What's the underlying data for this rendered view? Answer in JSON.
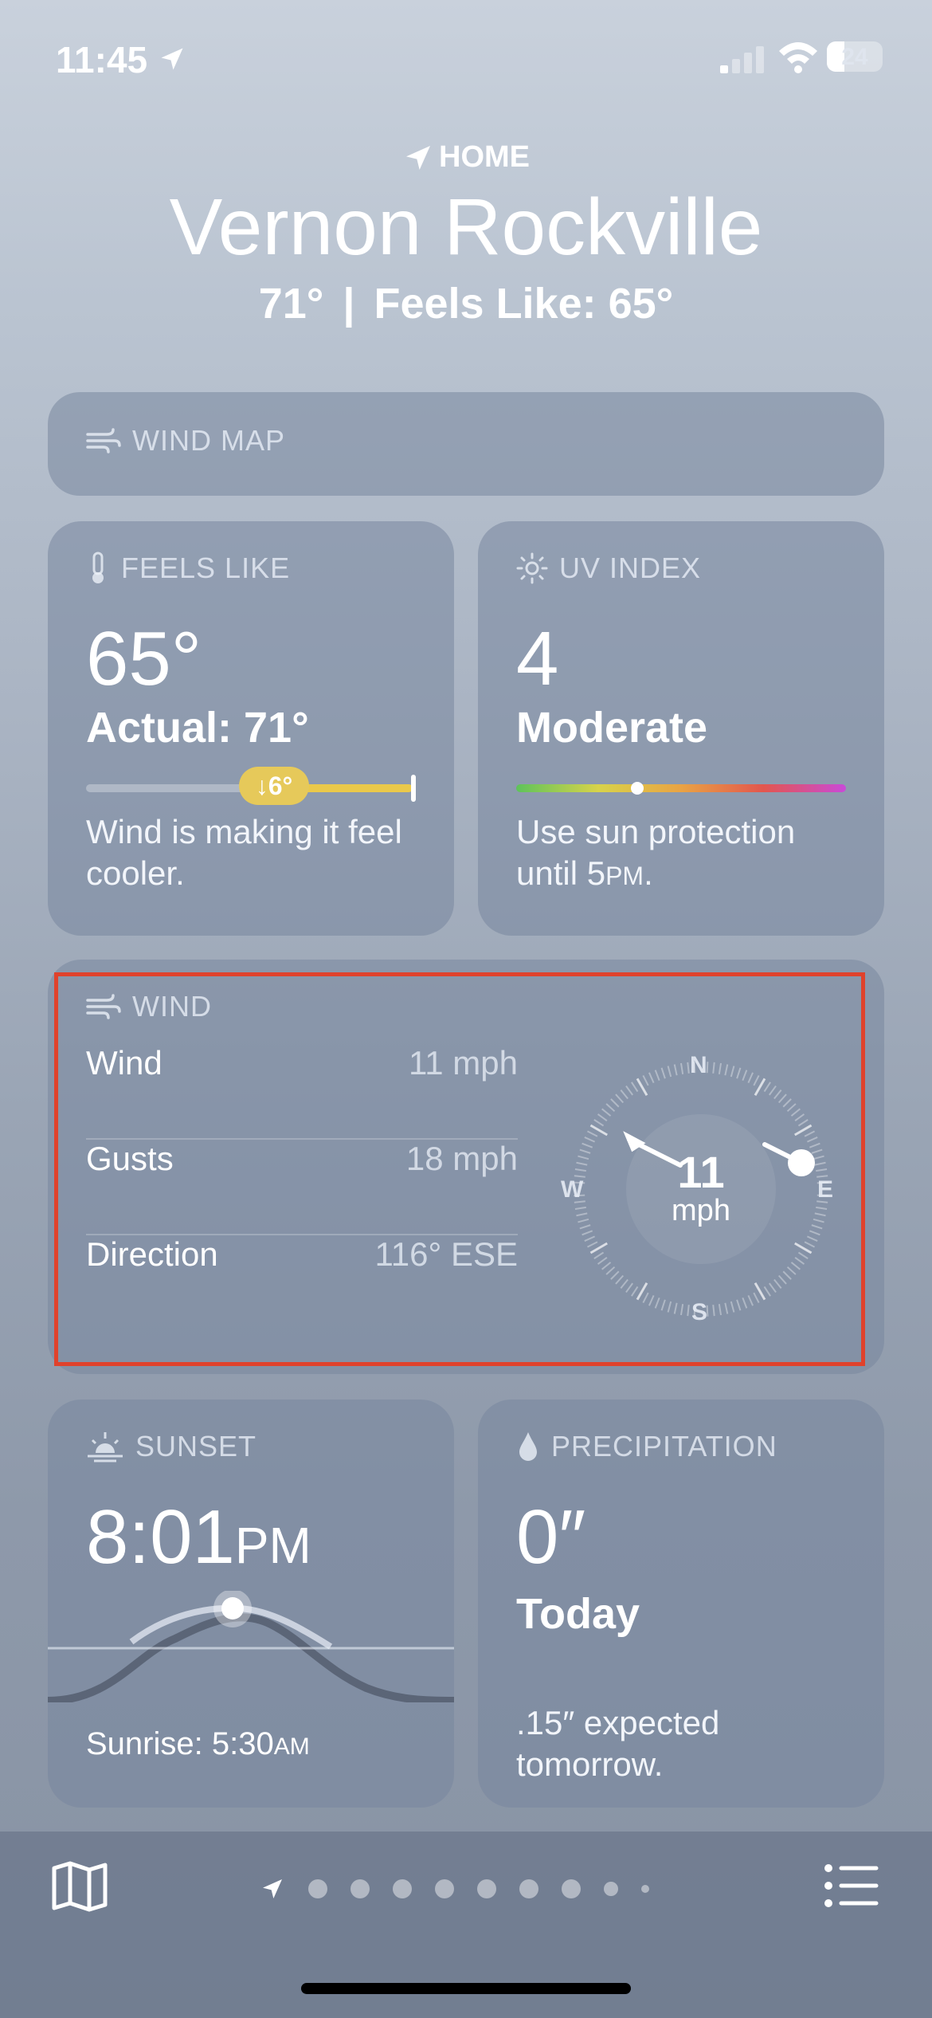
{
  "status": {
    "time": "11:45",
    "battery": "24"
  },
  "header": {
    "home_label": "HOME",
    "city": "Vernon Rockville",
    "temp": "71°",
    "separator": "|",
    "feels": "Feels Like: 65°"
  },
  "wind_map": {
    "title": "WIND MAP"
  },
  "feels_like": {
    "title": "FEELS LIKE",
    "value": "65°",
    "actual": "Actual: 71°",
    "badge": "↓6°",
    "desc": "Wind is making it feel cooler."
  },
  "uv": {
    "title": "UV INDEX",
    "value": "4",
    "level": "Moderate",
    "desc_1": "Use sun protection",
    "desc_2": "until 5",
    "desc_pm": "PM",
    "desc_end": "."
  },
  "wind": {
    "title": "WIND",
    "rows": [
      {
        "label": "Wind",
        "value": "11 mph"
      },
      {
        "label": "Gusts",
        "value": "18 mph"
      },
      {
        "label": "Direction",
        "value": "116° ESE"
      }
    ],
    "compass": {
      "speed": "11",
      "unit": "mph",
      "n": "N",
      "e": "E",
      "s": "S",
      "w": "W"
    }
  },
  "sunset": {
    "title": "SUNSET",
    "time": "8:01",
    "pm": "PM",
    "sunrise_label": "Sunrise: 5:30",
    "sunrise_am": "AM"
  },
  "precip": {
    "title": "PRECIPITATION",
    "value": "0″",
    "period": "Today",
    "desc": ".15″ expected tomorrow."
  }
}
